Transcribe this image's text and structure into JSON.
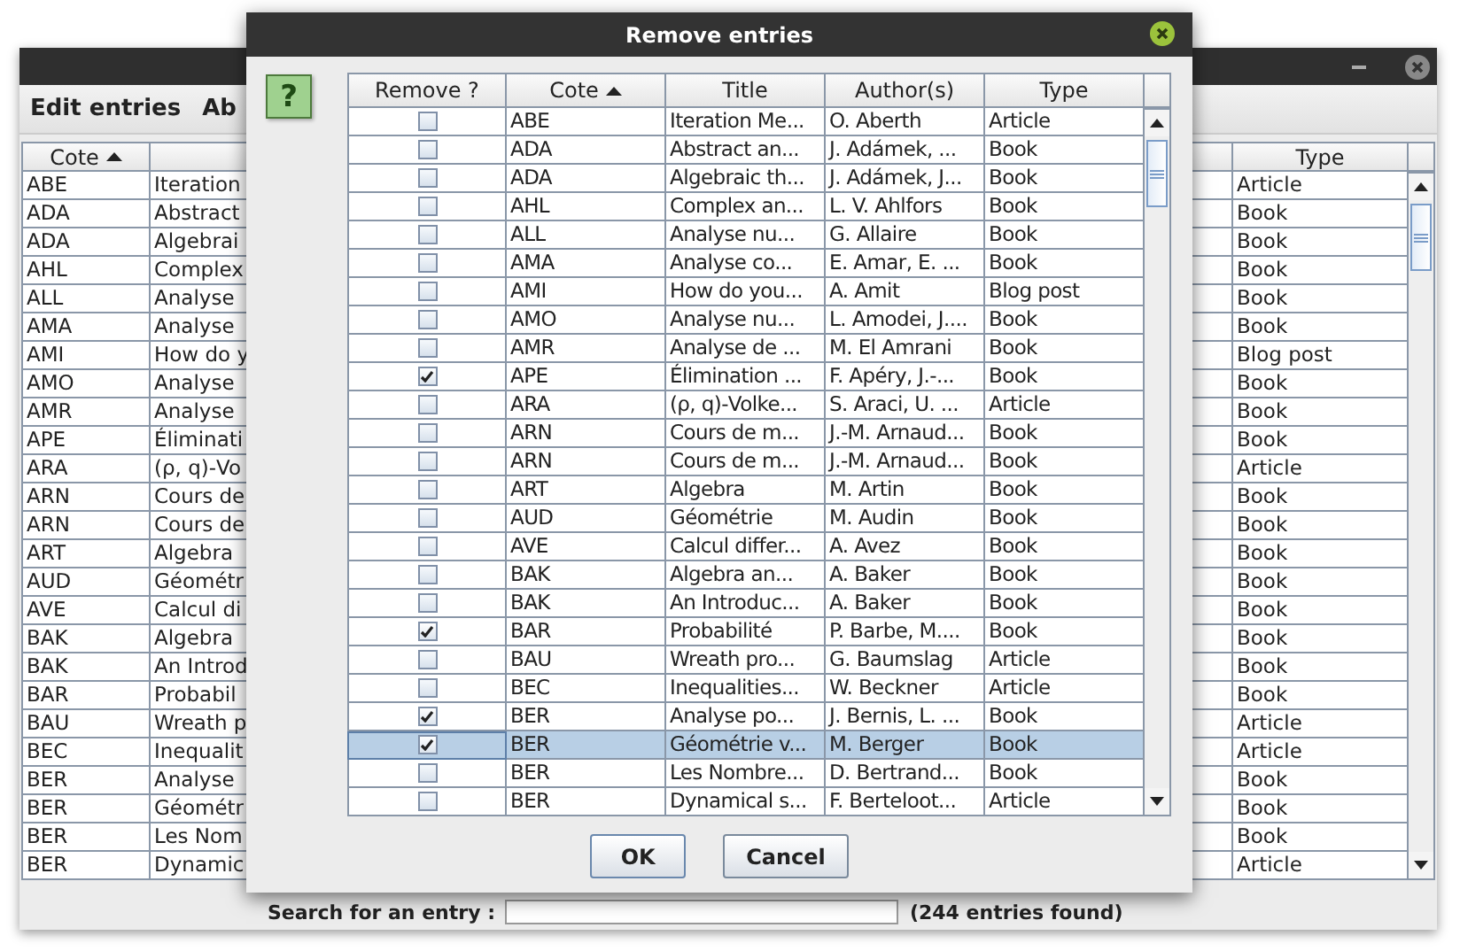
{
  "main_window": {
    "menu": [
      "Edit entries",
      "Ab"
    ],
    "table": {
      "columns": [
        {
          "label": "Cote",
          "sorted": true
        },
        {
          "label": "Type",
          "sorted": false
        }
      ],
      "rows": [
        {
          "cote": "ABE",
          "title": "Iteration",
          "type": "Article"
        },
        {
          "cote": "ADA",
          "title": "Abstract",
          "type": "Book"
        },
        {
          "cote": "ADA",
          "title": "Algebrai",
          "type": "Book"
        },
        {
          "cote": "AHL",
          "title": "Complex",
          "type": "Book"
        },
        {
          "cote": "ALL",
          "title": "Analyse",
          "type": "Book"
        },
        {
          "cote": "AMA",
          "title": "Analyse",
          "type": "Book"
        },
        {
          "cote": "AMI",
          "title": "How do y",
          "type": "Blog post"
        },
        {
          "cote": "AMO",
          "title": "Analyse",
          "type": "Book"
        },
        {
          "cote": "AMR",
          "title": "Analyse",
          "type": "Book"
        },
        {
          "cote": "APE",
          "title": "Éliminati",
          "type": "Book"
        },
        {
          "cote": "ARA",
          "title": "(ρ, q)-Vo",
          "type": "Article"
        },
        {
          "cote": "ARN",
          "title": "Cours de",
          "type": "Book"
        },
        {
          "cote": "ARN",
          "title": "Cours de",
          "type": "Book"
        },
        {
          "cote": "ART",
          "title": "Algebra",
          "type": "Book"
        },
        {
          "cote": "AUD",
          "title": "Géométr",
          "type": "Book"
        },
        {
          "cote": "AVE",
          "title": "Calcul di",
          "type": "Book"
        },
        {
          "cote": "BAK",
          "title": "Algebra",
          "type": "Book"
        },
        {
          "cote": "BAK",
          "title": "An Introd",
          "type": "Book"
        },
        {
          "cote": "BAR",
          "title": "Probabil",
          "type": "Book"
        },
        {
          "cote": "BAU",
          "title": "Wreath p",
          "type": "Article"
        },
        {
          "cote": "BEC",
          "title": "Inequalit",
          "type": "Article"
        },
        {
          "cote": "BER",
          "title": "Analyse",
          "type": "Book"
        },
        {
          "cote": "BER",
          "title": "Géométr",
          "type": "Book"
        },
        {
          "cote": "BER",
          "title": "Les Nom",
          "type": "Book"
        },
        {
          "cote": "BER",
          "title": "Dynamic",
          "type": "Article"
        }
      ]
    },
    "search": {
      "label": "Search for an entry :",
      "count": "(244 entries found)"
    }
  },
  "dialog": {
    "title": "Remove entries",
    "help": "?",
    "table": {
      "columns": [
        {
          "label": "Remove ?",
          "sorted": false
        },
        {
          "label": "Cote",
          "sorted": true
        },
        {
          "label": "Title",
          "sorted": false
        },
        {
          "label": "Author(s)",
          "sorted": false
        },
        {
          "label": "Type",
          "sorted": false
        }
      ],
      "rows": [
        {
          "checked": false,
          "selected": false,
          "cote": "ABE",
          "title": "Iteration Me...",
          "author": "O. Aberth",
          "type": "Article"
        },
        {
          "checked": false,
          "selected": false,
          "cote": "ADA",
          "title": "Abstract an...",
          "author": "J. Adámek, ...",
          "type": "Book"
        },
        {
          "checked": false,
          "selected": false,
          "cote": "ADA",
          "title": "Algebraic th...",
          "author": "J. Adámek, J...",
          "type": "Book"
        },
        {
          "checked": false,
          "selected": false,
          "cote": "AHL",
          "title": "Complex an...",
          "author": "L. V. Ahlfors",
          "type": "Book"
        },
        {
          "checked": false,
          "selected": false,
          "cote": "ALL",
          "title": "Analyse nu...",
          "author": "G. Allaire",
          "type": "Book"
        },
        {
          "checked": false,
          "selected": false,
          "cote": "AMA",
          "title": "Analyse co...",
          "author": "E. Amar, E. ...",
          "type": "Book"
        },
        {
          "checked": false,
          "selected": false,
          "cote": "AMI",
          "title": "How do you...",
          "author": "A. Amit",
          "type": "Blog post"
        },
        {
          "checked": false,
          "selected": false,
          "cote": "AMO",
          "title": "Analyse nu...",
          "author": "L. Amodei, J....",
          "type": "Book"
        },
        {
          "checked": false,
          "selected": false,
          "cote": "AMR",
          "title": "Analyse de ...",
          "author": "M. El Amrani",
          "type": "Book"
        },
        {
          "checked": true,
          "selected": false,
          "cote": "APE",
          "title": "Élimination ...",
          "author": "F. Apéry, J.-...",
          "type": "Book"
        },
        {
          "checked": false,
          "selected": false,
          "cote": "ARA",
          "title": "(ρ, q)-Volke...",
          "author": "S. Araci, U. ...",
          "type": "Article"
        },
        {
          "checked": false,
          "selected": false,
          "cote": "ARN",
          "title": "Cours de m...",
          "author": "J.-M. Arnaud...",
          "type": "Book"
        },
        {
          "checked": false,
          "selected": false,
          "cote": "ARN",
          "title": "Cours de m...",
          "author": "J.-M. Arnaud...",
          "type": "Book"
        },
        {
          "checked": false,
          "selected": false,
          "cote": "ART",
          "title": "Algebra",
          "author": "M. Artin",
          "type": "Book"
        },
        {
          "checked": false,
          "selected": false,
          "cote": "AUD",
          "title": "Géométrie",
          "author": "M. Audin",
          "type": "Book"
        },
        {
          "checked": false,
          "selected": false,
          "cote": "AVE",
          "title": "Calcul differ...",
          "author": "A. Avez",
          "type": "Book"
        },
        {
          "checked": false,
          "selected": false,
          "cote": "BAK",
          "title": "Algebra an...",
          "author": "A. Baker",
          "type": "Book"
        },
        {
          "checked": false,
          "selected": false,
          "cote": "BAK",
          "title": "An Introduc...",
          "author": "A. Baker",
          "type": "Book"
        },
        {
          "checked": true,
          "selected": false,
          "cote": "BAR",
          "title": "Probabilité",
          "author": "P. Barbe, M....",
          "type": "Book"
        },
        {
          "checked": false,
          "selected": false,
          "cote": "BAU",
          "title": "Wreath pro...",
          "author": "G. Baumslag",
          "type": "Article"
        },
        {
          "checked": false,
          "selected": false,
          "cote": "BEC",
          "title": "Inequalities...",
          "author": "W. Beckner",
          "type": "Article"
        },
        {
          "checked": true,
          "selected": false,
          "cote": "BER",
          "title": "Analyse po...",
          "author": "J. Bernis, L. ...",
          "type": "Book"
        },
        {
          "checked": true,
          "selected": true,
          "cote": "BER",
          "title": "Géométrie v...",
          "author": "M. Berger",
          "type": "Book"
        },
        {
          "checked": false,
          "selected": false,
          "cote": "BER",
          "title": "Les Nombre...",
          "author": "D. Bertrand...",
          "type": "Book"
        },
        {
          "checked": false,
          "selected": false,
          "cote": "BER",
          "title": "Dynamical s...",
          "author": "F. Berteloot...",
          "type": "Article"
        }
      ]
    },
    "buttons": [
      "OK",
      "Cancel"
    ]
  }
}
